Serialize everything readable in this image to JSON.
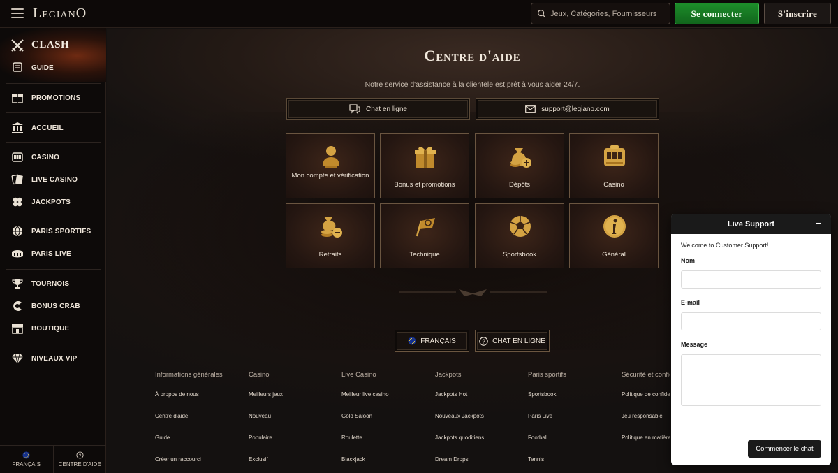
{
  "header": {
    "logo": "LegianO",
    "search_placeholder": "Jeux, Catégories, Fournisseurs",
    "login_label": "Se connecter",
    "signup_label": "S'inscrire"
  },
  "sidebar": {
    "clash_label": "CLASH",
    "guide_label": "GUIDE",
    "items": [
      {
        "label": "PROMOTIONS",
        "icon": "gift-box-icon"
      },
      {
        "label": "ACCUEIL",
        "icon": "building-icon"
      },
      {
        "label": "CASINO",
        "icon": "slot-machine-icon"
      },
      {
        "label": "LIVE CASINO",
        "icon": "cards-icon"
      },
      {
        "label": "JACKPOTS",
        "icon": "clover-icon"
      },
      {
        "label": "PARIS SPORTIFS",
        "icon": "globe-ball-icon"
      },
      {
        "label": "PARIS LIVE",
        "icon": "stadium-icon"
      },
      {
        "label": "TOURNOIS",
        "icon": "trophy-icon"
      },
      {
        "label": "BONUS CRAB",
        "icon": "crab-claw-icon"
      },
      {
        "label": "BOUTIQUE",
        "icon": "shop-icon"
      },
      {
        "label": "NIVEAUX VIP",
        "icon": "diamond-icon"
      }
    ],
    "footer_language": "FRANÇAIS",
    "footer_help": "CENTRE D'AIDE"
  },
  "main": {
    "title": "Centre d'aide",
    "subtitle": "Notre service d'assistance à la clientèle est prêt à vous aider 24/7.",
    "chat_button": "Chat en ligne",
    "email_button": "support@legiano.com",
    "tiles": [
      {
        "label": "Mon compte et vérification",
        "icon": "bust-icon"
      },
      {
        "label": "Bonus et promotions",
        "icon": "gift-icon"
      },
      {
        "label": "Dépôts",
        "icon": "money-bag-plus-icon"
      },
      {
        "label": "Casino",
        "icon": "slot-machine-icon"
      },
      {
        "label": "Retraits",
        "icon": "coins-minus-icon"
      },
      {
        "label": "Technique",
        "icon": "gear-flag-icon"
      },
      {
        "label": "Sportsbook",
        "icon": "football-icon"
      },
      {
        "label": "Général",
        "icon": "info-icon"
      }
    ],
    "language_button": "FRANÇAIS",
    "live_chat_button": "CHAT EN LIGNE"
  },
  "footer": {
    "columns": [
      {
        "head": "Informations générales",
        "links": [
          "À propos de nous",
          "Centre d'aide",
          "Guide",
          "Créer un raccourci"
        ]
      },
      {
        "head": "Casino",
        "links": [
          "Meilleurs jeux",
          "Nouveau",
          "Populaire",
          "Exclusif"
        ]
      },
      {
        "head": "Live Casino",
        "links": [
          "Meilleur live casino",
          "Gold Saloon",
          "Roulette",
          "Blackjack"
        ]
      },
      {
        "head": "Jackpots",
        "links": [
          "Jackpots Hot",
          "Nouveaux Jackpots",
          "Jackpots quoditiens",
          "Dream Drops"
        ]
      },
      {
        "head": "Paris sportifs",
        "links": [
          "Sportsbook",
          "Paris Live",
          "Football",
          "Tennis"
        ]
      },
      {
        "head": "Sécurité et confid",
        "links": [
          "Politique de confiden",
          "Jeu responsable",
          "Politique en matière c"
        ]
      }
    ]
  },
  "support": {
    "title": "Live Support",
    "minimize": "−",
    "welcome": "Welcome to Customer Support!",
    "name_label": "Nom",
    "email_label": "E-mail",
    "message_label": "Message",
    "start_button": "Commencer le chat"
  },
  "colors": {
    "accent_gold": "#d4a343",
    "login_green": "#1d8d2a",
    "background": "#141110"
  }
}
